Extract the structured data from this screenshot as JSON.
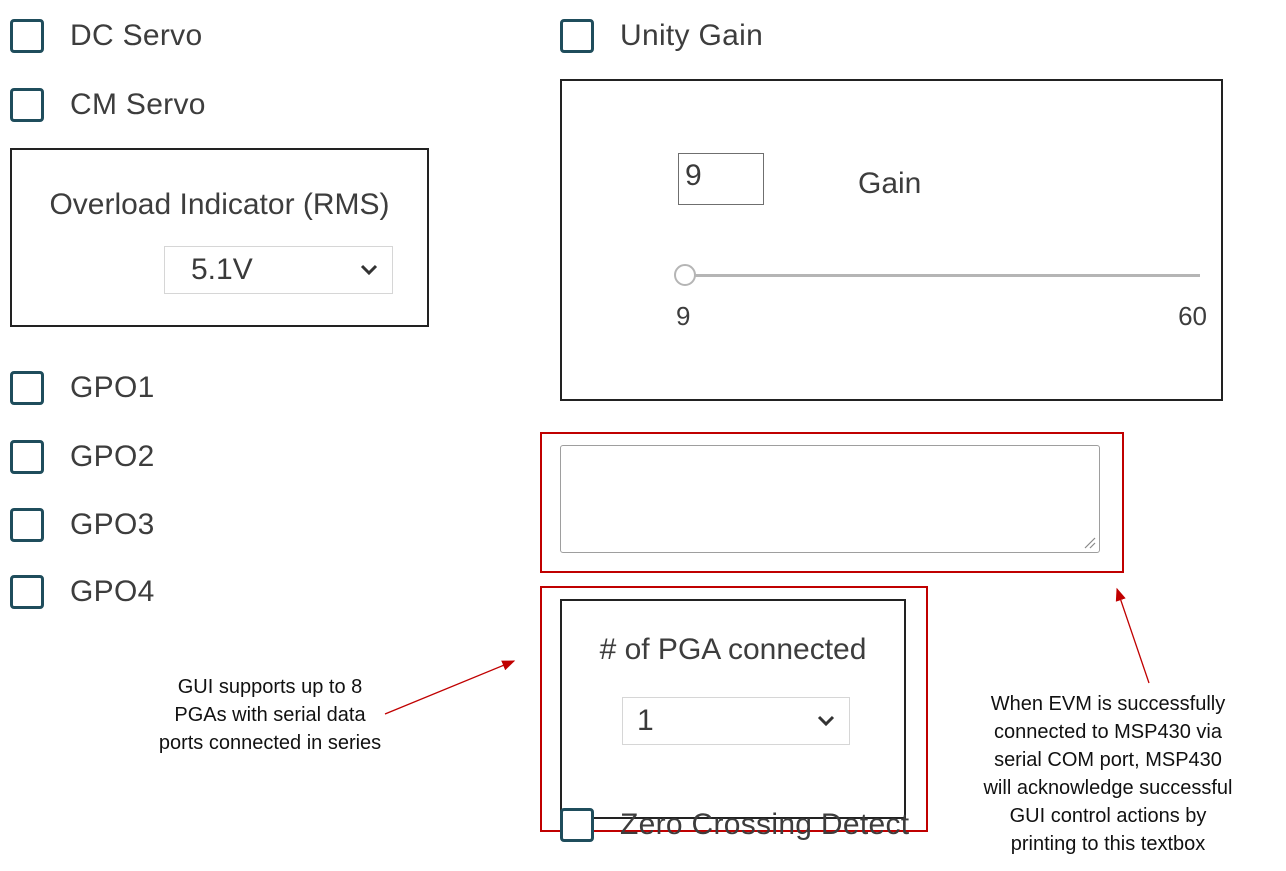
{
  "checkboxes": {
    "dc_servo": "DC Servo",
    "cm_servo": "CM Servo",
    "gpo1": "GPO1",
    "gpo2": "GPO2",
    "gpo3": "GPO3",
    "gpo4": "GPO4",
    "unity_gain": "Unity Gain",
    "zero_crossing": "Zero Crossing Detect"
  },
  "overload": {
    "title": "Overload Indicator (RMS)",
    "selected": "5.1V"
  },
  "gain": {
    "value": "9",
    "label": "Gain",
    "slider_min": "9",
    "slider_max": "60",
    "slider_value": 9
  },
  "log_textbox": {
    "value": ""
  },
  "pga": {
    "title": "# of PGA connected",
    "selected": "1"
  },
  "annotations": {
    "pga_note": [
      "GUI supports up to 8",
      "PGAs with serial data",
      "ports connected in series"
    ],
    "textbox_note": [
      "When EVM is successfully",
      "connected to MSP430 via",
      "serial COM port, MSP430",
      "will acknowledge successful",
      "GUI control actions by",
      "printing to this textbox"
    ]
  },
  "colors": {
    "checkbox_border": "#1f4d5c",
    "highlight": "#c00000",
    "annotation_arrow": "#c00000"
  },
  "icons": {
    "dropdown": "chevron-down-icon",
    "resize": "resize-handle-icon"
  }
}
